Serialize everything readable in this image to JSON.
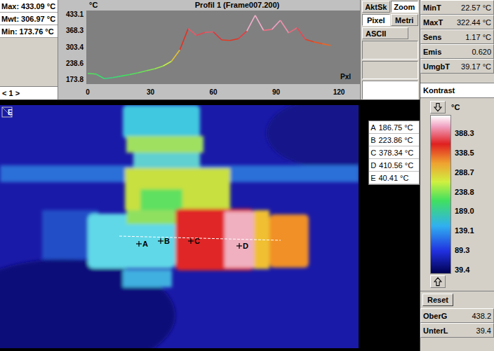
{
  "readout": [
    {
      "label": "Max:",
      "value": "433.09 °C"
    },
    {
      "label": "Mwt:",
      "value": "306.97 °C"
    },
    {
      "label": "Min:",
      "value": "173.76 °C"
    }
  ],
  "frame_nav": "< 1 >",
  "profile_chart": {
    "title": "Profil 1 (Frame007.200)",
    "unit": "°C",
    "x_label": "Pxl",
    "y_ticks": [
      "433.1",
      "368.3",
      "303.4",
      "238.6",
      "173.8"
    ],
    "x_ticks": [
      "0",
      "30",
      "60",
      "90",
      "120"
    ],
    "x_step": 4,
    "series": [
      {
        "name": "Profil 1",
        "values": [
          197,
          194,
          176,
          180,
          186,
          192,
          199,
          207,
          215,
          226,
          245,
          290,
          375,
          348,
          360,
          362,
          330,
          328,
          335,
          365,
          428,
          368,
          372,
          408,
          358,
          378,
          332,
          322,
          315,
          308
        ]
      }
    ]
  },
  "tool_buttons": [
    {
      "label": "AktSk",
      "selected": false,
      "kind": "toggle"
    },
    {
      "label": "Zoom",
      "selected": true,
      "kind": "toggle"
    },
    {
      "label": "Pixel",
      "selected": true,
      "kind": "toggle"
    },
    {
      "label": "Metri",
      "selected": false,
      "kind": "toggle"
    },
    {
      "label": "ASCII",
      "selected": false,
      "kind": "command"
    }
  ],
  "stats": [
    {
      "label": "MinT",
      "value": "22.57 °C"
    },
    {
      "label": "MaxT",
      "value": "322.44 °C"
    },
    {
      "label": "Sens",
      "value": "1.17 °C"
    },
    {
      "label": "Emis",
      "value": "0.620"
    },
    {
      "label": "UmgbT",
      "value": "39.17 °C"
    }
  ],
  "contrast": {
    "title": "Kontrast",
    "unit": "°C",
    "ticks": [
      "388.3",
      "338.5",
      "288.7",
      "238.8",
      "189.0",
      "139.1",
      "89.3",
      "39.4"
    ]
  },
  "reset_button": "Reset",
  "limits": [
    {
      "label": "OberG",
      "value": "438.2"
    },
    {
      "label": "UnterL",
      "value": "39.4"
    }
  ],
  "measurements": [
    {
      "label": "A",
      "value": "186.75 °C",
      "kind": "point"
    },
    {
      "label": "B",
      "value": "223.86 °C",
      "kind": "point"
    },
    {
      "label": "C",
      "value": "378.34 °C",
      "kind": "point"
    },
    {
      "label": "D",
      "value": "410.56 °C",
      "kind": "point"
    },
    {
      "label": "E",
      "value": "40.41 °C",
      "kind": "corner"
    }
  ]
}
